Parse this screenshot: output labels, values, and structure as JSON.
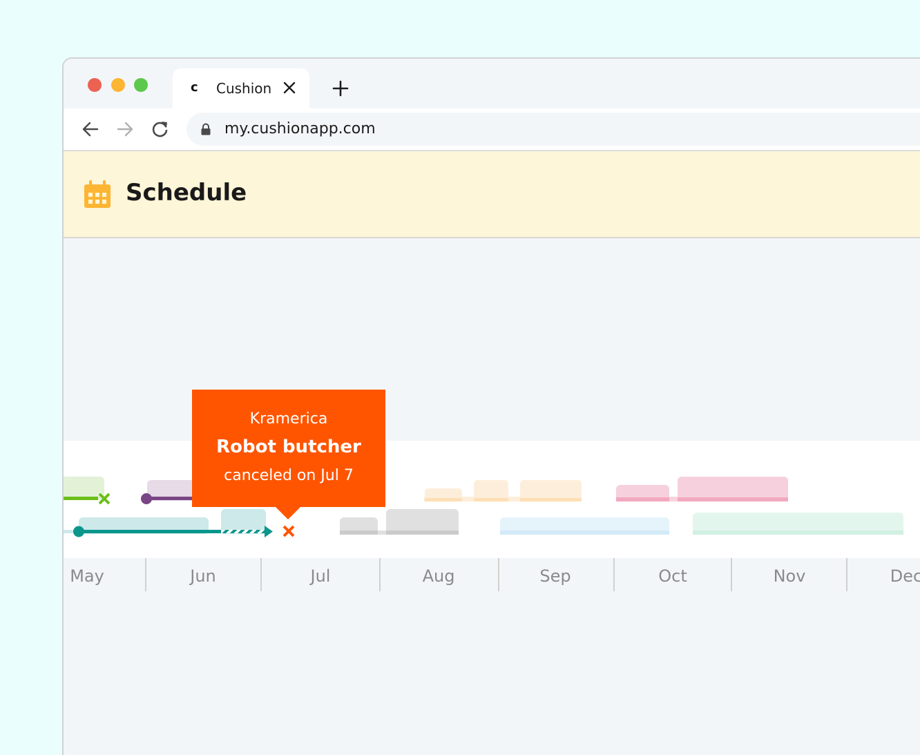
{
  "browser": {
    "tab": {
      "favicon": "c",
      "title": "Cushion"
    },
    "url": "my.cushionapp.com",
    "window_controls": [
      "close",
      "minimize",
      "maximize"
    ]
  },
  "app": {
    "page_title": "Schedule",
    "page_icon": "calendar-icon",
    "accent_color": "#fdb534",
    "header_bg": "#fdf6d8"
  },
  "timeline": {
    "months": [
      "May",
      "Jun",
      "Jul",
      "Aug",
      "Sep",
      "Oct",
      "Nov",
      "Dec"
    ],
    "projects": [
      {
        "name": "green-project",
        "color": "#6cbf1a",
        "status": "canceled",
        "row": 0
      },
      {
        "name": "purple-project",
        "color": "#7a4585",
        "status": "active",
        "row": 0
      },
      {
        "name": "Robot butcher",
        "client": "Kramerica",
        "color": "#0b968c",
        "status": "canceled",
        "canceled_date": "Jul 7",
        "row": 1
      },
      {
        "name": "orange-project",
        "color": "#ffc98a",
        "status": "scheduled",
        "row": 0
      },
      {
        "name": "gray-project",
        "color": "#c8c8c8",
        "status": "scheduled",
        "row": 1
      },
      {
        "name": "pink-project",
        "color": "#f0a0ba",
        "status": "scheduled",
        "row": 0
      },
      {
        "name": "blue-project",
        "color": "#bfe2f6",
        "status": "scheduled",
        "row": 1
      },
      {
        "name": "mint-project",
        "color": "#bdebd7",
        "status": "scheduled",
        "row": 1
      }
    ]
  },
  "tooltip": {
    "client": "Kramerica",
    "project": "Robot butcher",
    "status_text": "canceled on Jul 7",
    "color": "#ff5500"
  }
}
